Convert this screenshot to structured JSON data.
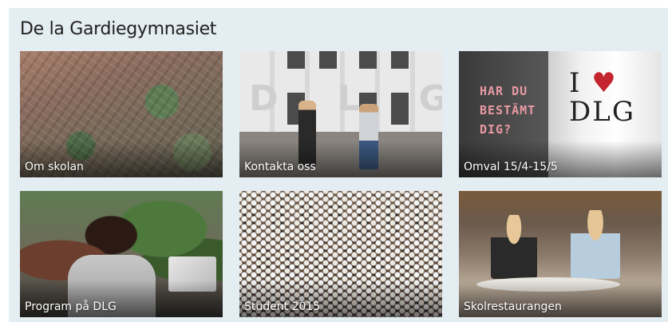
{
  "page": {
    "title": "De la Gardiegymnasiet"
  },
  "tiles": [
    {
      "label": "Om skolan"
    },
    {
      "label": "Kontakta oss",
      "image_text": "DLG"
    },
    {
      "label": "Omval 15/4-15/5",
      "image_text": {
        "poster_line1": "HAR DU",
        "poster_line2": "BESTÄMT",
        "poster_line3": "DIG?",
        "shirt_line1": "I",
        "shirt_line2": "DLG"
      }
    },
    {
      "label": "Program på DLG"
    },
    {
      "label": "Student 2015"
    },
    {
      "label": "Skolrestaurangen"
    }
  ],
  "colors": {
    "panel_bg": "#e4edf2",
    "title": "#1f1f1f",
    "label": "#ffffff",
    "heart": "#c3242d"
  }
}
